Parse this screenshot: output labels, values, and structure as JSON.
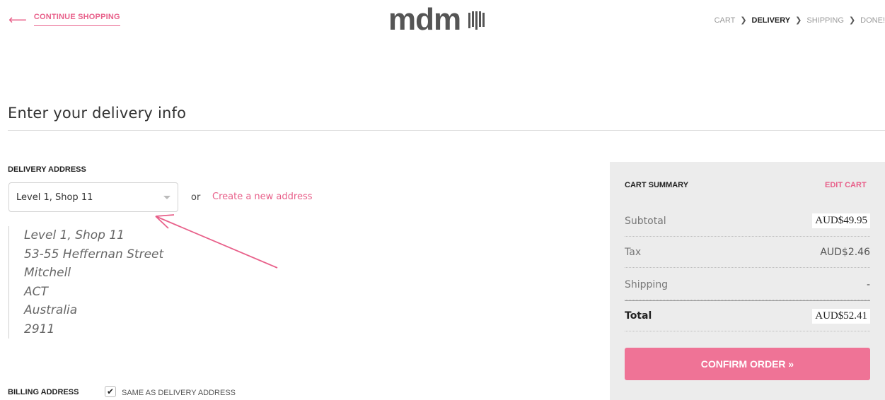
{
  "header": {
    "continue_label": "CONTINUE SHOPPING",
    "logo_text": "mdm",
    "steps": [
      "CART",
      "DELIVERY",
      "SHIPPING",
      "DONE!"
    ],
    "current_step": "DELIVERY"
  },
  "page": {
    "title": "Enter your delivery info"
  },
  "delivery": {
    "label": "DELIVERY ADDRESS",
    "selected_address": "Level 1, Shop 11",
    "or_text": "or",
    "create_link": "Create a new address",
    "address_lines": [
      "Level 1, Shop 11",
      "53-55 Heffernan Street",
      "Mitchell",
      "ACT",
      "Australia",
      "2911"
    ]
  },
  "billing": {
    "label": "BILLING ADDRESS",
    "same_as_delivery_label": "SAME AS DELIVERY ADDRESS",
    "same_as_delivery_checked": true
  },
  "cart": {
    "title": "CART SUMMARY",
    "edit_label": "EDIT CART",
    "subtotal_label": "Subtotal",
    "subtotal_value": "AUD$49.95",
    "tax_label": "Tax",
    "tax_value": "AUD$2.46",
    "shipping_label": "Shipping",
    "shipping_value": "-",
    "total_label": "Total",
    "total_value": "AUD$52.41",
    "confirm_label": "CONFIRM ORDER »"
  },
  "colors": {
    "accent": "#e8608a",
    "button": "#ef7396",
    "panel": "#ececec"
  }
}
